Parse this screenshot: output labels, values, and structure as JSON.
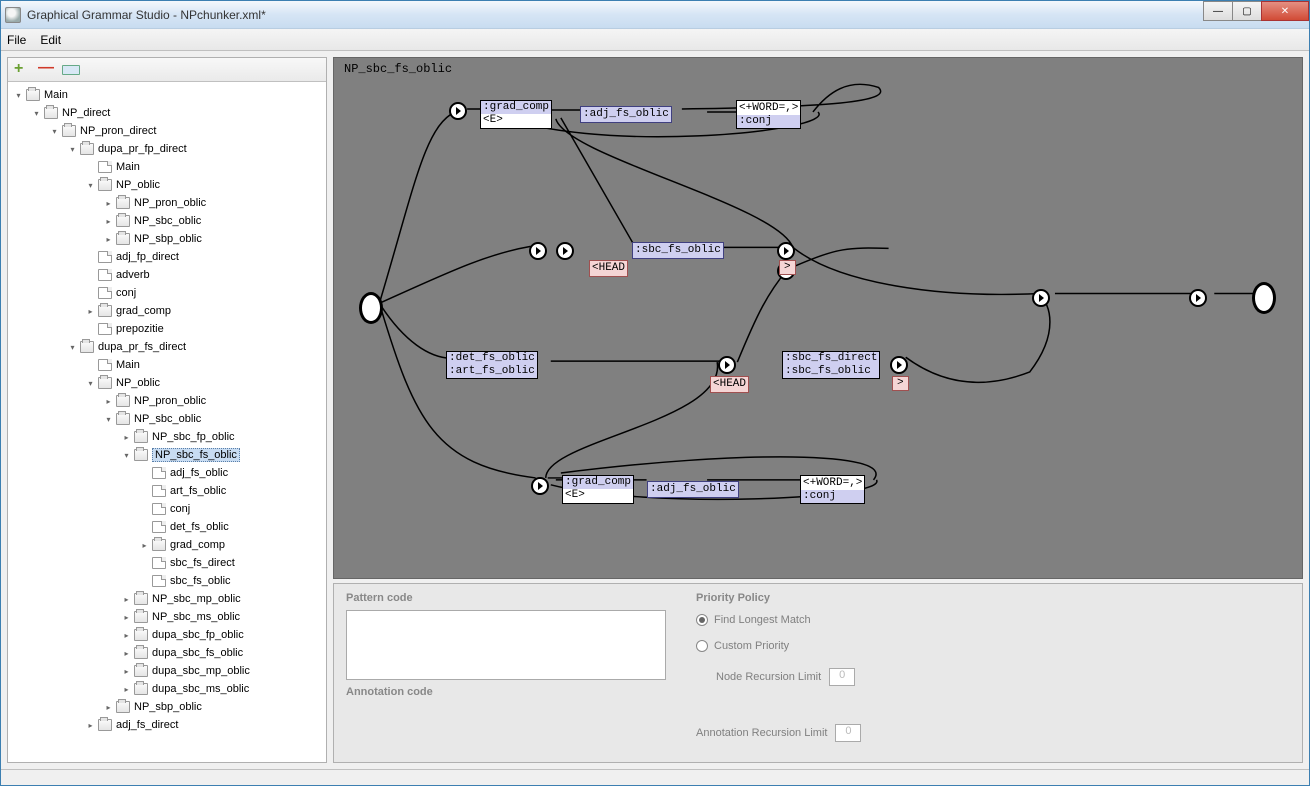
{
  "window": {
    "title": "Graphical Grammar Studio - NPchunker.xml*"
  },
  "menubar": {
    "file": "File",
    "edit": "Edit"
  },
  "graph": {
    "title": "NP_sbc_fs_oblic",
    "nodes": {
      "grad_comp1_a": ":grad_comp",
      "grad_comp1_b": "<E>",
      "adj1": ":adj_fs_oblic",
      "word1_a": "<+WORD=,>",
      "word1_b": ":conj",
      "sbc_fs": ":sbc_fs_oblic",
      "head1": "<HEAD",
      "gt1": ">",
      "det_a": ":det_fs_oblic",
      "det_b": ":art_fs_oblic",
      "head2": "<HEAD",
      "sbc_dir_a": ":sbc_fs_direct",
      "sbc_dir_b": ":sbc_fs_oblic",
      "gt2": ">",
      "grad_comp2_a": ":grad_comp",
      "grad_comp2_b": "<E>",
      "adj2": ":adj_fs_oblic",
      "word2_a": "<+WORD=,>",
      "word2_b": ":conj"
    }
  },
  "bottom": {
    "pattern_label": "Pattern code",
    "annotation_label": "Annotation code",
    "priority_label": "Priority Policy",
    "opt_longest": "Find Longest Match",
    "opt_custom": "Custom Priority",
    "node_limit_label": "Node Recursion Limit",
    "ann_limit_label": "Annotation Recursion Limit",
    "node_limit_val": "0",
    "ann_limit_val": "0"
  },
  "tree": [
    {
      "d": 0,
      "e": "open",
      "t": "folder",
      "l": "Main"
    },
    {
      "d": 1,
      "e": "open",
      "t": "folder",
      "l": "NP_direct"
    },
    {
      "d": 2,
      "e": "open",
      "t": "folder",
      "l": "NP_pron_direct"
    },
    {
      "d": 3,
      "e": "open",
      "t": "folder",
      "l": "dupa_pr_fp_direct"
    },
    {
      "d": 4,
      "e": "none",
      "t": "file",
      "l": "Main"
    },
    {
      "d": 4,
      "e": "open",
      "t": "folder",
      "l": "NP_oblic"
    },
    {
      "d": 5,
      "e": "closed",
      "t": "folder",
      "l": "NP_pron_oblic"
    },
    {
      "d": 5,
      "e": "closed",
      "t": "folder",
      "l": "NP_sbc_oblic"
    },
    {
      "d": 5,
      "e": "closed",
      "t": "folder",
      "l": "NP_sbp_oblic"
    },
    {
      "d": 4,
      "e": "none",
      "t": "file",
      "l": "adj_fp_direct"
    },
    {
      "d": 4,
      "e": "none",
      "t": "file",
      "l": "adverb"
    },
    {
      "d": 4,
      "e": "none",
      "t": "file",
      "l": "conj"
    },
    {
      "d": 4,
      "e": "closed",
      "t": "folder",
      "l": "grad_comp"
    },
    {
      "d": 4,
      "e": "none",
      "t": "file",
      "l": "prepozitie"
    },
    {
      "d": 3,
      "e": "open",
      "t": "folder",
      "l": "dupa_pr_fs_direct"
    },
    {
      "d": 4,
      "e": "none",
      "t": "file",
      "l": "Main"
    },
    {
      "d": 4,
      "e": "open",
      "t": "folder",
      "l": "NP_oblic"
    },
    {
      "d": 5,
      "e": "closed",
      "t": "folder",
      "l": "NP_pron_oblic"
    },
    {
      "d": 5,
      "e": "open",
      "t": "folder",
      "l": "NP_sbc_oblic"
    },
    {
      "d": 6,
      "e": "closed",
      "t": "folder",
      "l": "NP_sbc_fp_oblic"
    },
    {
      "d": 6,
      "e": "open",
      "t": "folder",
      "l": "NP_sbc_fs_oblic",
      "sel": true
    },
    {
      "d": 7,
      "e": "none",
      "t": "file",
      "l": "adj_fs_oblic"
    },
    {
      "d": 7,
      "e": "none",
      "t": "file",
      "l": "art_fs_oblic"
    },
    {
      "d": 7,
      "e": "none",
      "t": "file",
      "l": "conj"
    },
    {
      "d": 7,
      "e": "none",
      "t": "file",
      "l": "det_fs_oblic"
    },
    {
      "d": 7,
      "e": "closed",
      "t": "folder",
      "l": "grad_comp"
    },
    {
      "d": 7,
      "e": "none",
      "t": "file",
      "l": "sbc_fs_direct"
    },
    {
      "d": 7,
      "e": "none",
      "t": "file",
      "l": "sbc_fs_oblic"
    },
    {
      "d": 6,
      "e": "closed",
      "t": "folder",
      "l": "NP_sbc_mp_oblic"
    },
    {
      "d": 6,
      "e": "closed",
      "t": "folder",
      "l": "NP_sbc_ms_oblic"
    },
    {
      "d": 6,
      "e": "closed",
      "t": "folder",
      "l": "dupa_sbc_fp_oblic"
    },
    {
      "d": 6,
      "e": "closed",
      "t": "folder",
      "l": "dupa_sbc_fs_oblic"
    },
    {
      "d": 6,
      "e": "closed",
      "t": "folder",
      "l": "dupa_sbc_mp_oblic"
    },
    {
      "d": 6,
      "e": "closed",
      "t": "folder",
      "l": "dupa_sbc_ms_oblic"
    },
    {
      "d": 5,
      "e": "closed",
      "t": "folder",
      "l": "NP_sbp_oblic"
    },
    {
      "d": 4,
      "e": "closed",
      "t": "folder",
      "l": "adj_fs_direct"
    }
  ]
}
